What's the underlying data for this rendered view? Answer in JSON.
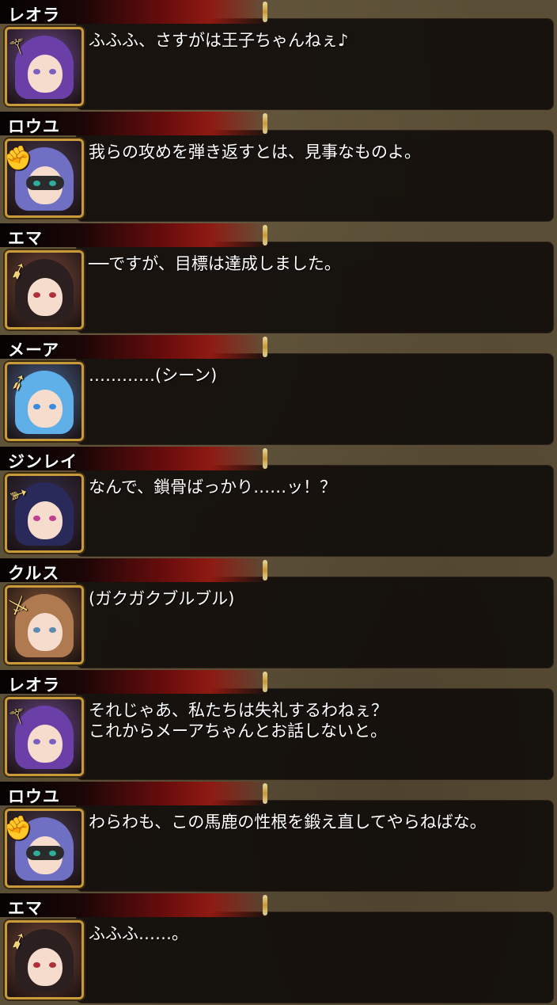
{
  "dialogue": [
    {
      "speaker": "レオラ",
      "lines": [
        "ふふふ、さすがは王子ちゃんねぇ♪"
      ],
      "class_icon": "staff-icon",
      "portrait": {
        "bg": "#6b4a8a",
        "hair": "#6a3fa8",
        "eye": "#7a5fc0"
      }
    },
    {
      "speaker": "ロウユ",
      "lines": [
        "我らの攻めを弾き返すとは、見事なものよ。"
      ],
      "class_icon": "fist-icon",
      "portrait": {
        "bg": "#4a3d52",
        "hair": "#6f6fc4",
        "eye": "#2fae9a",
        "mask": true
      }
    },
    {
      "speaker": "エマ",
      "lines": [
        "──ですが、目標は達成しました。"
      ],
      "class_icon": "crossbow-icon",
      "portrait": {
        "bg": "#7a4a3a",
        "hair": "#2b1f1f",
        "eye": "#b0303a"
      }
    },
    {
      "speaker": "メーア",
      "lines": [
        "…………(シーン)"
      ],
      "class_icon": "spear-icon",
      "portrait": {
        "bg": "#4a6a9a",
        "hair": "#5fb0e8",
        "eye": "#3a8ae0"
      }
    },
    {
      "speaker": "ジンレイ",
      "lines": [
        "なんで、鎖骨ばっかり……ッ！？"
      ],
      "class_icon": "bow-icon",
      "portrait": {
        "bg": "#3a3250",
        "hair": "#2a2a5a",
        "eye": "#c04090"
      }
    },
    {
      "speaker": "クルス",
      "lines": [
        "(ガクガクブルブル)"
      ],
      "class_icon": "sword-icon",
      "portrait": {
        "bg": "#8a5a3a",
        "hair": "#b07a50",
        "eye": "#5a8ab0"
      }
    },
    {
      "speaker": "レオラ",
      "lines": [
        "それじゃあ、私たちは失礼するわねぇ？",
        "これからメーアちゃんとお話しないと。"
      ],
      "class_icon": "staff-icon",
      "portrait": {
        "bg": "#6b4a8a",
        "hair": "#6a3fa8",
        "eye": "#7a5fc0"
      }
    },
    {
      "speaker": "ロウユ",
      "lines": [
        "わらわも、この馬鹿の性根を鍛え直してやらねばな。"
      ],
      "class_icon": "fist-icon",
      "portrait": {
        "bg": "#4a3d52",
        "hair": "#6f6fc4",
        "eye": "#2fae9a",
        "mask": true
      }
    },
    {
      "speaker": "エマ",
      "lines": [
        "ふふふ……。"
      ],
      "class_icon": "crossbow-icon",
      "portrait": {
        "bg": "#7a4a3a",
        "hair": "#2b1f1f",
        "eye": "#b0303a"
      }
    }
  ]
}
